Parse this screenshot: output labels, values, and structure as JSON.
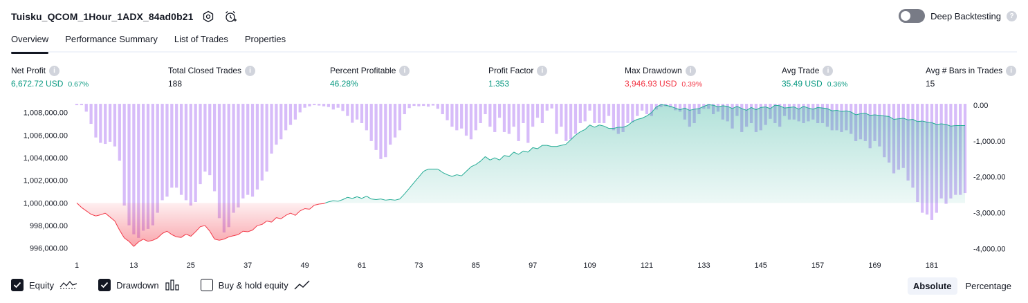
{
  "header": {
    "title": "Tuisku_QCOM_1Hour_1ADX_84ad0b21"
  },
  "deep_backtesting": {
    "label": "Deep Backtesting",
    "help": "?"
  },
  "tabs": [
    {
      "label": "Overview",
      "active": true
    },
    {
      "label": "Performance Summary"
    },
    {
      "label": "List of Trades"
    },
    {
      "label": "Properties"
    }
  ],
  "metrics": [
    {
      "label": "Net Profit",
      "value": "6,672.72 USD",
      "pct": "0.67%"
    },
    {
      "label": "Total Closed Trades",
      "value": "188"
    },
    {
      "label": "Percent Profitable",
      "value": "46.28%"
    },
    {
      "label": "Profit Factor",
      "value": "1.353"
    },
    {
      "label": "Max Drawdown",
      "value": "3,946.93 USD",
      "pct": "0.39%"
    },
    {
      "label": "Avg Trade",
      "value": "35.49 USD",
      "pct": "0.36%"
    },
    {
      "label": "Avg # Bars in Trades",
      "value": "15"
    }
  ],
  "legend": {
    "equity": "Equity",
    "drawdown": "Drawdown",
    "buy_hold": "Buy & hold equity"
  },
  "modes": {
    "absolute": "Absolute",
    "percentage": "Percentage"
  },
  "colors": {
    "positive": "#089981",
    "negative": "#f23645",
    "drawdown_bar": "#c9a6f7",
    "equity_line_up": "#22ab94",
    "equity_line_down": "#f23645"
  },
  "chart_data": {
    "type": "area",
    "x_ticks": [
      "1",
      "13",
      "25",
      "37",
      "49",
      "61",
      "73",
      "85",
      "97",
      "109",
      "121",
      "133",
      "145",
      "157",
      "169",
      "181"
    ],
    "left_axis": {
      "ticks": [
        "1,008,000.00",
        "1,006,000.00",
        "1,004,000.00",
        "1,002,000.00",
        "1,000,000.00",
        "998,000.00",
        "996,000.00"
      ],
      "range": [
        995800,
        1008900
      ],
      "baseline": 1000000
    },
    "right_axis": {
      "ticks": [
        "0.00",
        "-1,000.00",
        "-2,000.00",
        "-3,000.00",
        "-4,000.00"
      ],
      "range": [
        -4050,
        40
      ]
    },
    "equity": [
      [
        1,
        1000000
      ],
      [
        2,
        999600
      ],
      [
        3,
        999300
      ],
      [
        4,
        999000
      ],
      [
        5,
        998850
      ],
      [
        6,
        998950
      ],
      [
        7,
        999100
      ],
      [
        8,
        998750
      ],
      [
        9,
        998400
      ],
      [
        10,
        997600
      ],
      [
        11,
        996900
      ],
      [
        12,
        996600
      ],
      [
        13,
        996150
      ],
      [
        14,
        996550
      ],
      [
        15,
        996800
      ],
      [
        16,
        996600
      ],
      [
        17,
        996700
      ],
      [
        18,
        996900
      ],
      [
        19,
        997300
      ],
      [
        20,
        997500
      ],
      [
        21,
        997200
      ],
      [
        22,
        997000
      ],
      [
        23,
        996950
      ],
      [
        24,
        997250
      ],
      [
        25,
        997050
      ],
      [
        26,
        997450
      ],
      [
        27,
        997900
      ],
      [
        28,
        998000
      ],
      [
        29,
        997500
      ],
      [
        30,
        996800
      ],
      [
        31,
        996700
      ],
      [
        32,
        996800
      ],
      [
        33,
        997000
      ],
      [
        34,
        997100
      ],
      [
        35,
        997200
      ],
      [
        36,
        997500
      ],
      [
        37,
        997450
      ],
      [
        38,
        997600
      ],
      [
        39,
        998000
      ],
      [
        40,
        998100
      ],
      [
        41,
        998400
      ],
      [
        42,
        998300
      ],
      [
        43,
        998700
      ],
      [
        44,
        998600
      ],
      [
        45,
        998900
      ],
      [
        46,
        999100
      ],
      [
        47,
        998900
      ],
      [
        48,
        999300
      ],
      [
        49,
        999500
      ],
      [
        50,
        999450
      ],
      [
        51,
        999800
      ],
      [
        52,
        999900
      ],
      [
        53,
        999950
      ],
      [
        54,
        1000100
      ],
      [
        55,
        1000200
      ],
      [
        56,
        1000150
      ],
      [
        57,
        1000300
      ],
      [
        58,
        1000500
      ],
      [
        59,
        1000400
      ],
      [
        60,
        1000550
      ],
      [
        61,
        1000400
      ],
      [
        62,
        1000600
      ],
      [
        63,
        1000350
      ],
      [
        64,
        1000300
      ],
      [
        65,
        1000350
      ],
      [
        66,
        1000250
      ],
      [
        67,
        1000300
      ],
      [
        68,
        1000250
      ],
      [
        69,
        1000350
      ],
      [
        70,
        1000800
      ],
      [
        71,
        1001300
      ],
      [
        72,
        1001800
      ],
      [
        73,
        1002300
      ],
      [
        74,
        1002800
      ],
      [
        75,
        1003000
      ],
      [
        76,
        1003000
      ],
      [
        77,
        1003000
      ],
      [
        78,
        1002700
      ],
      [
        79,
        1002500
      ],
      [
        80,
        1002350
      ],
      [
        81,
        1002500
      ],
      [
        82,
        1002400
      ],
      [
        83,
        1002800
      ],
      [
        84,
        1003200
      ],
      [
        85,
        1003400
      ],
      [
        86,
        1003700
      ],
      [
        87,
        1004100
      ],
      [
        88,
        1003800
      ],
      [
        89,
        1004000
      ],
      [
        90,
        1003800
      ],
      [
        91,
        1004200
      ],
      [
        92,
        1004100
      ],
      [
        93,
        1004500
      ],
      [
        94,
        1004300
      ],
      [
        95,
        1004600
      ],
      [
        96,
        1004500
      ],
      [
        97,
        1004900
      ],
      [
        98,
        1004800
      ],
      [
        99,
        1005100
      ],
      [
        100,
        1005100
      ],
      [
        101,
        1005000
      ],
      [
        102,
        1005000
      ],
      [
        103,
        1005100
      ],
      [
        104,
        1005200
      ],
      [
        105,
        1005600
      ],
      [
        106,
        1006000
      ],
      [
        107,
        1006300
      ],
      [
        108,
        1006500
      ],
      [
        109,
        1006900
      ],
      [
        110,
        1006700
      ],
      [
        111,
        1006900
      ],
      [
        112,
        1006800
      ],
      [
        113,
        1006600
      ],
      [
        114,
        1006600
      ],
      [
        115,
        1006700
      ],
      [
        116,
        1006700
      ],
      [
        117,
        1006850
      ],
      [
        118,
        1007200
      ],
      [
        119,
        1007400
      ],
      [
        120,
        1007500
      ],
      [
        121,
        1007700
      ],
      [
        122,
        1008000
      ],
      [
        123,
        1008500
      ],
      [
        124,
        1008700
      ],
      [
        125,
        1008650
      ],
      [
        126,
        1008550
      ],
      [
        127,
        1008400
      ],
      [
        128,
        1008250
      ],
      [
        129,
        1008400
      ],
      [
        130,
        1008200
      ],
      [
        131,
        1008300
      ],
      [
        132,
        1008350
      ],
      [
        133,
        1008550
      ],
      [
        134,
        1008700
      ],
      [
        135,
        1008650
      ],
      [
        136,
        1008500
      ],
      [
        137,
        1008600
      ],
      [
        138,
        1008550
      ],
      [
        139,
        1008350
      ],
      [
        140,
        1008550
      ],
      [
        141,
        1008350
      ],
      [
        142,
        1008200
      ],
      [
        143,
        1008450
      ],
      [
        144,
        1008250
      ],
      [
        145,
        1008450
      ],
      [
        146,
        1008500
      ],
      [
        147,
        1008350
      ],
      [
        148,
        1008650
      ],
      [
        149,
        1008600
      ],
      [
        150,
        1008400
      ],
      [
        151,
        1008450
      ],
      [
        152,
        1008500
      ],
      [
        153,
        1008300
      ],
      [
        154,
        1008550
      ],
      [
        155,
        1008400
      ],
      [
        156,
        1008300
      ],
      [
        157,
        1008450
      ],
      [
        158,
        1008400
      ],
      [
        159,
        1008350
      ],
      [
        160,
        1008150
      ],
      [
        161,
        1008200
      ],
      [
        162,
        1008100
      ],
      [
        163,
        1008150
      ],
      [
        164,
        1008050
      ],
      [
        165,
        1007800
      ],
      [
        166,
        1007900
      ],
      [
        167,
        1007950
      ],
      [
        168,
        1007750
      ],
      [
        169,
        1007800
      ],
      [
        170,
        1007750
      ],
      [
        171,
        1007700
      ],
      [
        172,
        1007650
      ],
      [
        173,
        1007400
      ],
      [
        174,
        1007450
      ],
      [
        175,
        1007500
      ],
      [
        176,
        1007350
      ],
      [
        177,
        1007400
      ],
      [
        178,
        1007200
      ],
      [
        179,
        1007250
      ],
      [
        180,
        1007150
      ],
      [
        181,
        1007100
      ],
      [
        182,
        1006950
      ],
      [
        183,
        1007000
      ],
      [
        184,
        1006950
      ],
      [
        185,
        1006800
      ],
      [
        186,
        1006850
      ],
      [
        187,
        1006850
      ],
      [
        188,
        1006850
      ]
    ],
    "drawdown": [
      [
        1,
        0
      ],
      [
        2,
        0
      ],
      [
        3,
        -180
      ],
      [
        4,
        -520
      ],
      [
        5,
        -900
      ],
      [
        6,
        -1050
      ],
      [
        7,
        -1080
      ],
      [
        8,
        -1020
      ],
      [
        9,
        -1150
      ],
      [
        10,
        -1550
      ],
      [
        11,
        -2800
      ],
      [
        12,
        -3350
      ],
      [
        13,
        -3600
      ],
      [
        14,
        -3700
      ],
      [
        15,
        -3500
      ],
      [
        16,
        -3450
      ],
      [
        17,
        -3350
      ],
      [
        18,
        -3000
      ],
      [
        19,
        -2650
      ],
      [
        20,
        -2550
      ],
      [
        21,
        -2300
      ],
      [
        22,
        -2300
      ],
      [
        23,
        -2500
      ],
      [
        24,
        -2650
      ],
      [
        25,
        -2800
      ],
      [
        26,
        -2700
      ],
      [
        27,
        -2200
      ],
      [
        28,
        -1850
      ],
      [
        29,
        -1950
      ],
      [
        30,
        -2400
      ],
      [
        31,
        -3150
      ],
      [
        32,
        -3550
      ],
      [
        33,
        -3400
      ],
      [
        34,
        -3000
      ],
      [
        35,
        -2850
      ],
      [
        36,
        -2600
      ],
      [
        37,
        -2500
      ],
      [
        38,
        -2550
      ],
      [
        39,
        -2350
      ],
      [
        40,
        -2100
      ],
      [
        41,
        -1850
      ],
      [
        42,
        -1350
      ],
      [
        43,
        -1100
      ],
      [
        44,
        -950
      ],
      [
        45,
        -700
      ],
      [
        46,
        -550
      ],
      [
        47,
        -400
      ],
      [
        48,
        -200
      ],
      [
        49,
        -70
      ],
      [
        50,
        -30
      ],
      [
        51,
        0
      ],
      [
        52,
        -10
      ],
      [
        53,
        -30
      ],
      [
        54,
        -50
      ],
      [
        55,
        -120
      ],
      [
        56,
        -70
      ],
      [
        57,
        -160
      ],
      [
        58,
        -300
      ],
      [
        59,
        -490
      ],
      [
        60,
        -400
      ],
      [
        61,
        -500
      ],
      [
        62,
        -700
      ],
      [
        63,
        -1000
      ],
      [
        64,
        -1250
      ],
      [
        65,
        -1500
      ],
      [
        66,
        -1450
      ],
      [
        67,
        -1100
      ],
      [
        68,
        -900
      ],
      [
        69,
        -700
      ],
      [
        70,
        -250
      ],
      [
        71,
        -80
      ],
      [
        72,
        -20
      ],
      [
        73,
        -30
      ],
      [
        74,
        -20
      ],
      [
        75,
        -40
      ],
      [
        76,
        -10
      ],
      [
        77,
        -100
      ],
      [
        78,
        -250
      ],
      [
        79,
        -420
      ],
      [
        80,
        -600
      ],
      [
        81,
        -700
      ],
      [
        82,
        -650
      ],
      [
        83,
        -850
      ],
      [
        84,
        -950
      ],
      [
        85,
        -700
      ],
      [
        86,
        -500
      ],
      [
        87,
        -250
      ],
      [
        88,
        -600
      ],
      [
        89,
        -750
      ],
      [
        90,
        -350
      ],
      [
        91,
        -750
      ],
      [
        92,
        -800
      ],
      [
        93,
        -600
      ],
      [
        94,
        -1000
      ],
      [
        95,
        -500
      ],
      [
        96,
        -1050
      ],
      [
        97,
        -600
      ],
      [
        98,
        -350
      ],
      [
        99,
        -500
      ],
      [
        100,
        -150
      ],
      [
        101,
        -90
      ],
      [
        102,
        -800
      ],
      [
        103,
        -600
      ],
      [
        104,
        -1000
      ],
      [
        105,
        -950
      ],
      [
        106,
        -800
      ],
      [
        107,
        -500
      ],
      [
        108,
        -450
      ],
      [
        109,
        -150
      ],
      [
        110,
        -500
      ],
      [
        111,
        -500
      ],
      [
        112,
        -500
      ],
      [
        113,
        -300
      ],
      [
        114,
        -700
      ],
      [
        115,
        -800
      ],
      [
        116,
        -750
      ],
      [
        117,
        -500
      ],
      [
        118,
        -480
      ],
      [
        119,
        -300
      ],
      [
        120,
        -150
      ],
      [
        121,
        -250
      ],
      [
        122,
        -300
      ],
      [
        123,
        -120
      ],
      [
        124,
        -50
      ],
      [
        125,
        -30
      ],
      [
        126,
        -60
      ],
      [
        127,
        -140
      ],
      [
        128,
        -180
      ],
      [
        129,
        -400
      ],
      [
        130,
        -600
      ],
      [
        131,
        -500
      ],
      [
        132,
        -250
      ],
      [
        133,
        -100
      ],
      [
        134,
        -100
      ],
      [
        135,
        -250
      ],
      [
        136,
        -180
      ],
      [
        137,
        -400
      ],
      [
        138,
        -450
      ],
      [
        139,
        -650
      ],
      [
        140,
        -300
      ],
      [
        141,
        -750
      ],
      [
        142,
        -600
      ],
      [
        143,
        -500
      ],
      [
        144,
        -750
      ],
      [
        145,
        -700
      ],
      [
        146,
        -550
      ],
      [
        147,
        -380
      ],
      [
        148,
        -500
      ],
      [
        149,
        -600
      ],
      [
        150,
        -300
      ],
      [
        151,
        -400
      ],
      [
        152,
        -400
      ],
      [
        153,
        -450
      ],
      [
        154,
        -500
      ],
      [
        155,
        -450
      ],
      [
        156,
        -400
      ],
      [
        157,
        -500
      ],
      [
        158,
        -500
      ],
      [
        159,
        -600
      ],
      [
        160,
        -700
      ],
      [
        161,
        -700
      ],
      [
        162,
        -750
      ],
      [
        163,
        -700
      ],
      [
        164,
        -800
      ],
      [
        165,
        -1000
      ],
      [
        166,
        -950
      ],
      [
        167,
        -1000
      ],
      [
        168,
        -1200
      ],
      [
        169,
        -1000
      ],
      [
        170,
        -1150
      ],
      [
        171,
        -1450
      ],
      [
        172,
        -1600
      ],
      [
        173,
        -1900
      ],
      [
        174,
        -1800
      ],
      [
        175,
        -1750
      ],
      [
        176,
        -2100
      ],
      [
        177,
        -2300
      ],
      [
        178,
        -2700
      ],
      [
        179,
        -3000
      ],
      [
        180,
        -3050
      ],
      [
        181,
        -3200
      ],
      [
        182,
        -3000
      ],
      [
        183,
        -2600
      ],
      [
        184,
        -2750
      ],
      [
        185,
        -2600
      ],
      [
        186,
        -2500
      ],
      [
        187,
        -2500
      ],
      [
        188,
        -2450
      ]
    ]
  }
}
